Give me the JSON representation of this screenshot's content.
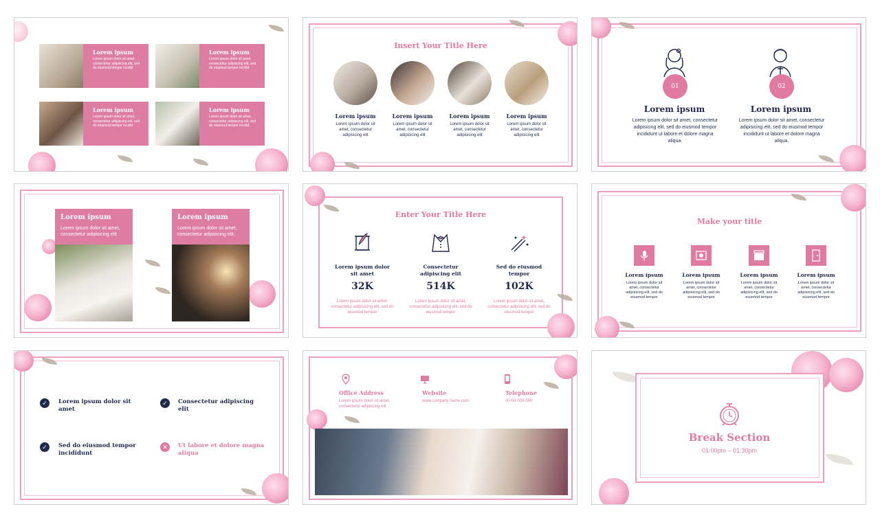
{
  "colors": {
    "accent": "#de7da2",
    "navy": "#1f2a4a",
    "frame": "#ee9dbf"
  },
  "s1": {
    "items": [
      {
        "title": "Lorem ipsum",
        "text": "Lorem ipsum dolor sit amet, consectetur adipiscing elit, sed do eiusmod tempor incidid"
      },
      {
        "title": "Lorem ipsum",
        "text": "Lorem ipsum dolor sit amet, consectetur adipiscing elit, sed do eiusmod tempor incidid"
      },
      {
        "title": "Lorem ipsum",
        "text": "Lorem ipsum dolor sit amet, consectetur adipiscing elit, sed do eiusmod tempor incidid"
      },
      {
        "title": "Lorem ipsum",
        "text": "Lorem ipsum dolor sit amet, consectetur adipiscing elit, sed do eiusmod tempor incidid"
      }
    ]
  },
  "s2": {
    "title": "Insert Your Title Here",
    "items": [
      {
        "title": "Lorem ipsum",
        "text": "Lorem ipsum dolor sit amet, consectetur adipisicing elit"
      },
      {
        "title": "Lorem ipsum",
        "text": "Lorem ipsum dolor sit amet, consectetur adipisicing elit"
      },
      {
        "title": "Lorem ipsum",
        "text": "Lorem ipsum dolor sit amet, consectetur adipisicing elit"
      },
      {
        "title": "Lorem ipsum",
        "text": "Lorem ipsum dolor sit amet, consectetur adipisicing elit"
      }
    ]
  },
  "s3": {
    "items": [
      {
        "num": "01",
        "title": "Lorem ipsum",
        "text": "Lorem ipsum dolor sit amet, consectetur adipisicing elit, sed do eiusmod tempor incididunt ut labore et dolore magna aliqua.",
        "icon": "bride-icon"
      },
      {
        "num": "02",
        "title": "Lorem ipsum",
        "text": "Lorem ipsum dolor sit amet, consectetur adipisicing elit, sed do eiusmod tempor incididunt ut labore et dolore magna aliqua.",
        "icon": "groom-icon"
      }
    ]
  },
  "s4": {
    "items": [
      {
        "title": "Lorem ipsum",
        "text": "Lorem ipsum dolor sit amet, consectetur adipisicing elit."
      },
      {
        "title": "Lorem ipsum",
        "text": "Lorem ipsum dolor sit amet, consectetur adipisicing elit."
      }
    ]
  },
  "s5": {
    "title": "Enter Your Title Here",
    "items": [
      {
        "title": "Lorem ipsum dolor sit amet",
        "stat": "32K",
        "text": "Lorem ipsum dolor sit amet, consectetur adipisicing elit, sed do eiusmod tempor",
        "icon": "scroll-quill-icon"
      },
      {
        "title": "Consectetur adipiscing elit",
        "stat": "514K",
        "text": "Lorem ipsum dolor sit amet, consectetur adipisicing elit, sed do eiusmod tempor",
        "icon": "tuxedo-icon"
      },
      {
        "title": "Sed do eiusmod tempor",
        "stat": "102K",
        "text": "Lorem ipsum dolor sit amet, consectetur adipisicing elit, sed do eiusmod tempor",
        "icon": "fireworks-icon"
      }
    ]
  },
  "s6": {
    "title": "Make your title",
    "items": [
      {
        "title": "Lorem ipsum",
        "text": "Lorem ipsum dolor sit amet, consectetur adipisicing elit, sed do eiusmod tempor",
        "icon": "microphone-icon"
      },
      {
        "title": "Lorem ipsum",
        "text": "Lorem ipsum dolor sit amet, consectetur adipisicing elit, sed do eiusmod tempor",
        "icon": "photo-icon"
      },
      {
        "title": "Lorem ipsum",
        "text": "Lorem ipsum dolor sit amet, consectetur adipisicing elit, sed do eiusmod tempor",
        "icon": "clapper-icon"
      },
      {
        "title": "Lorem ipsum",
        "text": "Lorem ipsum dolor sit amet, consectetur adipisicing elit, sed do eiusmod tempor",
        "icon": "door-icon"
      }
    ]
  },
  "s7": {
    "items": [
      {
        "text": "Lorem ipsum dolor sit amet",
        "state": "check"
      },
      {
        "text": "Consectetur adipiscing elit",
        "state": "check"
      },
      {
        "text": "Sed do eiusmod tempor incididunt",
        "state": "check"
      },
      {
        "text": "Ut labore et dolore magna aliqua",
        "state": "cross"
      }
    ]
  },
  "s8": {
    "items": [
      {
        "label": "Office Address",
        "value": "Lorem ipsum dolor sit amet, consectetur adipiscing elit",
        "icon": "location-icon"
      },
      {
        "label": "Website",
        "value": "www.company name.com",
        "icon": "monitor-icon"
      },
      {
        "label": "Telephone",
        "value": "00-00-000-000",
        "icon": "phone-icon"
      }
    ]
  },
  "s9": {
    "title": "Break Section",
    "time": "01:00pm – 01:30pm",
    "icon": "alarm-clock-icon"
  }
}
